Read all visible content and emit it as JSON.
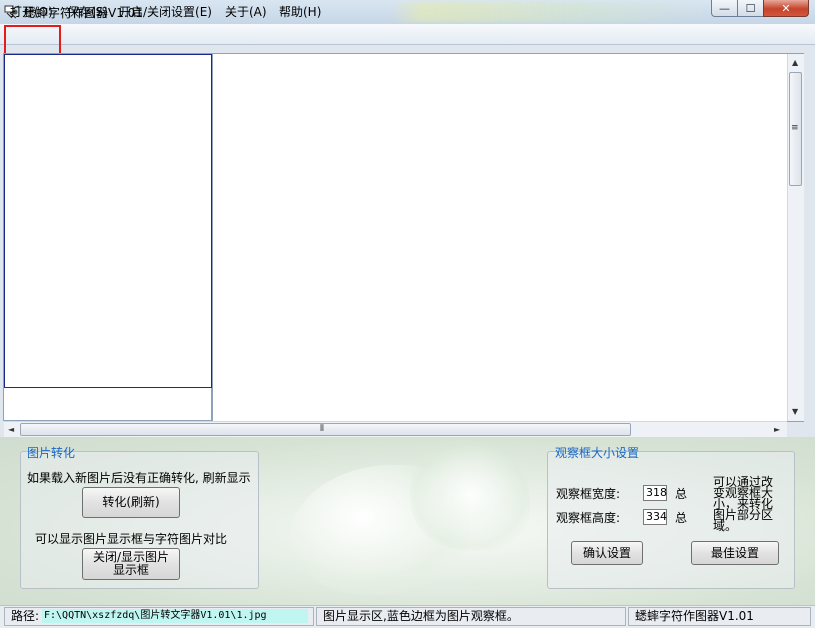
{
  "window": {
    "title": "蟋蟀字符作图器V1.01",
    "min_glyph": "—",
    "max_glyph": "☐",
    "close_glyph": "✕",
    "app_icon": "cricket-app-icon"
  },
  "menu": {
    "items": [
      "打开(O)",
      "保存(S)",
      "开启/关闭设置(E)",
      "关于(A)",
      "帮助(H)"
    ]
  },
  "scroll": {
    "up": "▲",
    "down": "▼",
    "left": "◄",
    "right": "►",
    "grip_v": "≡",
    "grip_h": "⦀"
  },
  "image_convert": {
    "title": "图片转化",
    "hint1": "如果载入新图片后没有正确转化, 刷新显示",
    "convert_button": "转化(刷新)",
    "hint2": "可以显示图片显示框与字符图片对比",
    "toggle_button_line1": "关闭/显示图片",
    "toggle_button_line2": "显示框"
  },
  "viewport_settings": {
    "title": "观察框大小设置",
    "width_label": "观察框宽度:",
    "width_value": "318",
    "width_unit": "总",
    "height_label": "观察框高度:",
    "height_value": "334",
    "height_unit": "总",
    "note": "可以通过改变观察框大小，来转化图片部分区域。",
    "confirm_button": "确认设置",
    "best_button": "最佳设置"
  },
  "status": {
    "path_label": "路径:",
    "path_value": "F:\\QQTN\\xszfzdq\\图片转文字器V1.01\\1.jpg",
    "message": "图片显示区,蓝色边框为图片观察框。",
    "app_name": "蟋蟀字符作图器V1.01"
  },
  "colors": {
    "highlight": "#e31c1c",
    "group_title": "#1a66c4",
    "observe_border": "#1b2a8a",
    "path_bg": "#bff6f2"
  }
}
